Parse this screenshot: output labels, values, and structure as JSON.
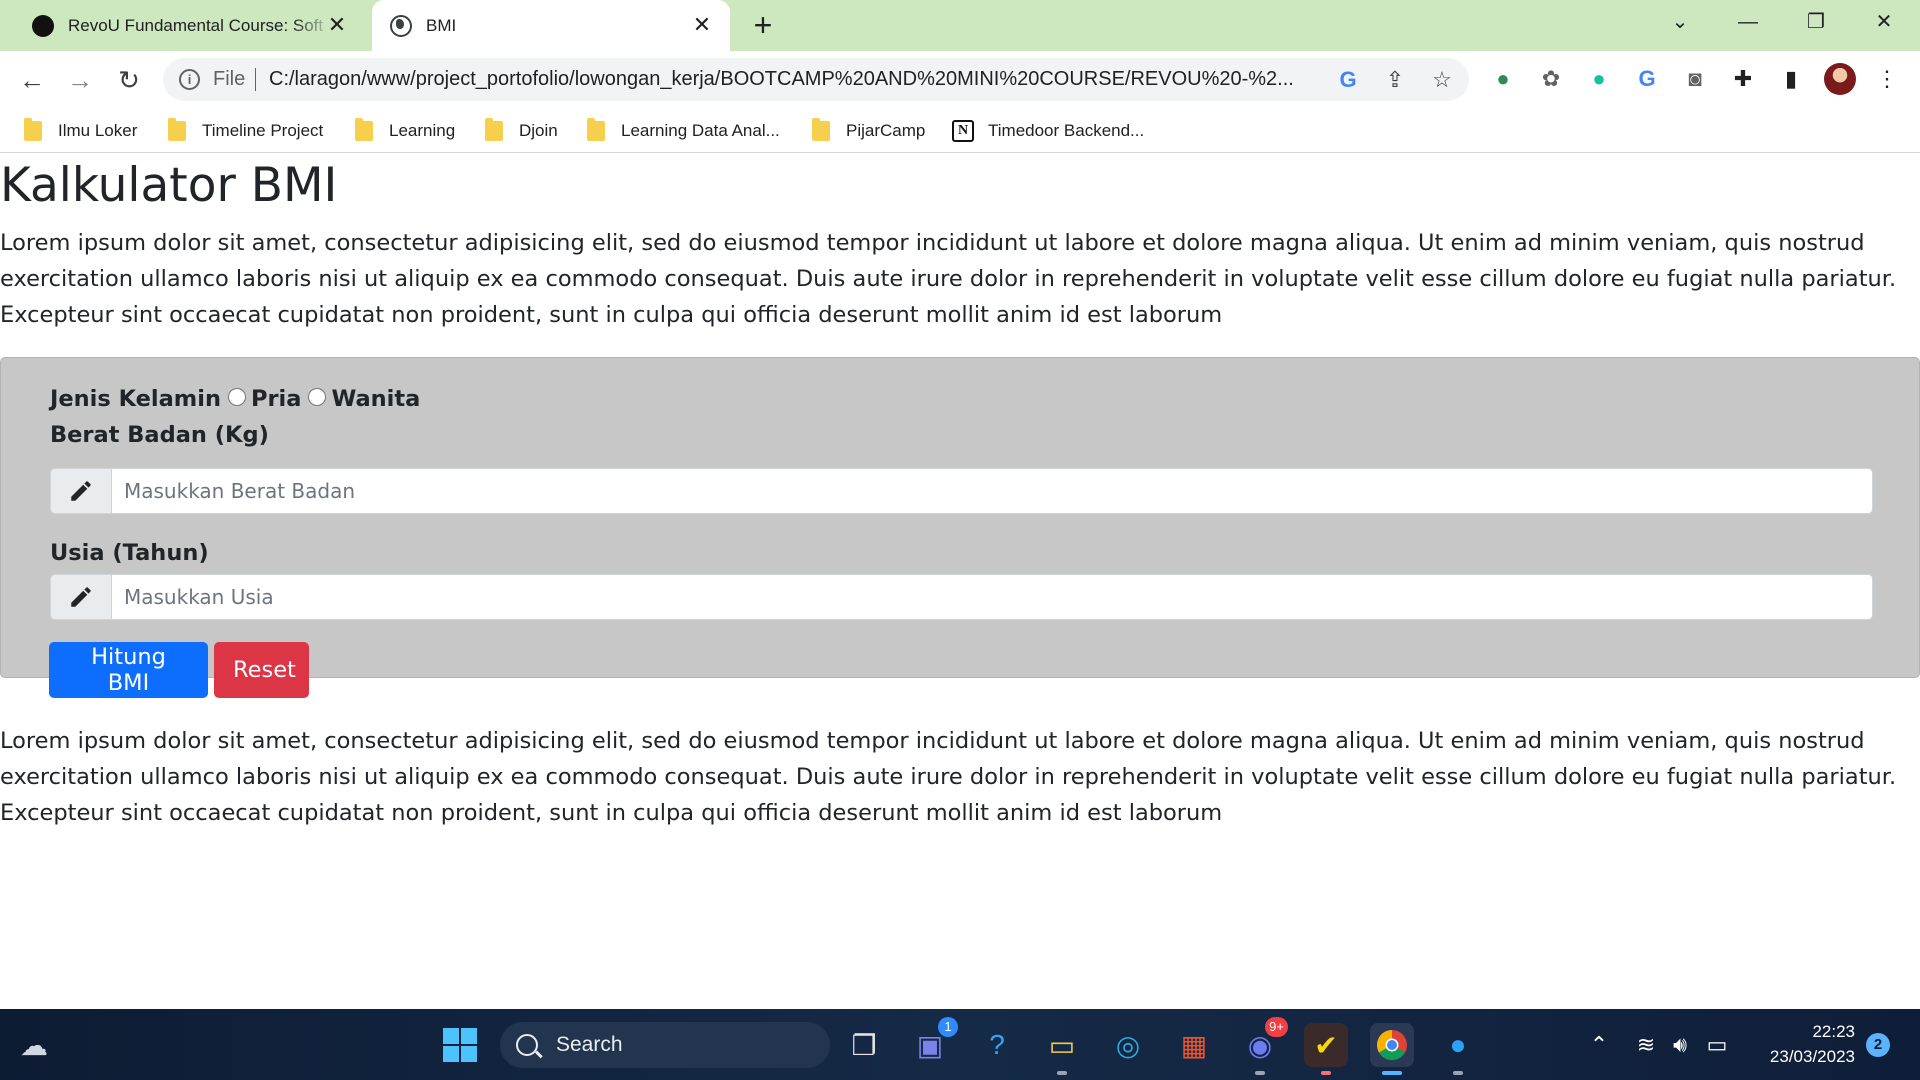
{
  "browser": {
    "tabs": [
      {
        "title": "RevoU Fundamental Course: Soft",
        "active": false
      },
      {
        "title": "BMI",
        "active": true
      }
    ],
    "new_tab": "+",
    "controls": {
      "tab_search": "⌄",
      "minimize": "—",
      "restore": "❐",
      "close": "✕"
    },
    "omnibox": {
      "scheme_label": "File",
      "url": "C:/laragon/www/project_portofolio/lowongan_kerja/BOOTCAMP%20AND%20MINI%20COURSE/REVOU%20-%2..."
    },
    "bookmarks": [
      {
        "label": "Ilmu Loker",
        "icon": "folder-icon"
      },
      {
        "label": "Timeline Project",
        "icon": "folder-icon"
      },
      {
        "label": "Learning",
        "icon": "folder-icon"
      },
      {
        "label": "Djoin",
        "icon": "folder-icon"
      },
      {
        "label": "Learning Data Anal...",
        "icon": "folder-icon"
      },
      {
        "label": "PijarCamp",
        "icon": "folder-icon"
      },
      {
        "label": "Timedoor Backend...",
        "icon": "notion-icon"
      }
    ],
    "extensions": [
      "colorful-globe-icon",
      "openai-icon",
      "grammarly-icon",
      "translate-icon",
      "camera-icon",
      "puzzle-icon",
      "sidebar-icon",
      "avatar"
    ]
  },
  "page": {
    "title": "Kalkulator BMI",
    "intro": "Lorem ipsum dolor sit amet, consectetur adipisicing elit, sed do eiusmod tempor incididunt ut labore et dolore magna aliqua. Ut enim ad minim veniam, quis nostrud exercitation ullamco laboris nisi ut aliquip ex ea commodo consequat. Duis aute irure dolor in reprehenderit in voluptate velit esse cillum dolore eu fugiat nulla pariatur. Excepteur sint occaecat cupidatat non proident, sunt in culpa qui officia deserunt mollit anim id est laborum",
    "outro": "Lorem ipsum dolor sit amet, consectetur adipisicing elit, sed do eiusmod tempor incididunt ut labore et dolore magna aliqua. Ut enim ad minim veniam, quis nostrud exercitation ullamco laboris nisi ut aliquip ex ea commodo consequat. Duis aute irure dolor in reprehenderit in voluptate velit esse cillum dolore eu fugiat nulla pariatur. Excepteur sint occaecat cupidatat non proident, sunt in culpa qui officia deserunt mollit anim id est laborum",
    "form": {
      "gender_label": "Jenis Kelamin",
      "gender_options": [
        "Pria",
        "Wanita"
      ],
      "weight_label": "Berat Badan (Kg)",
      "weight_placeholder": "Masukkan Berat Badan",
      "weight_value": "",
      "age_label": "Usia (Tahun)",
      "age_placeholder": "Masukkan Usia",
      "age_value": "",
      "submit_label": "Hitung BMI",
      "reset_label": "Reset"
    }
  },
  "taskbar": {
    "search_label": "Search",
    "teams_badge": "1",
    "discord_badge": "9+",
    "clock_time": "22:23",
    "clock_date": "23/03/2023",
    "notification_count": "2"
  },
  "colors": {
    "tab_strip": "#cde8be",
    "primary_button": "#0d6efd",
    "danger_button": "#dc3545",
    "form_panel": "#c7c7c7"
  }
}
